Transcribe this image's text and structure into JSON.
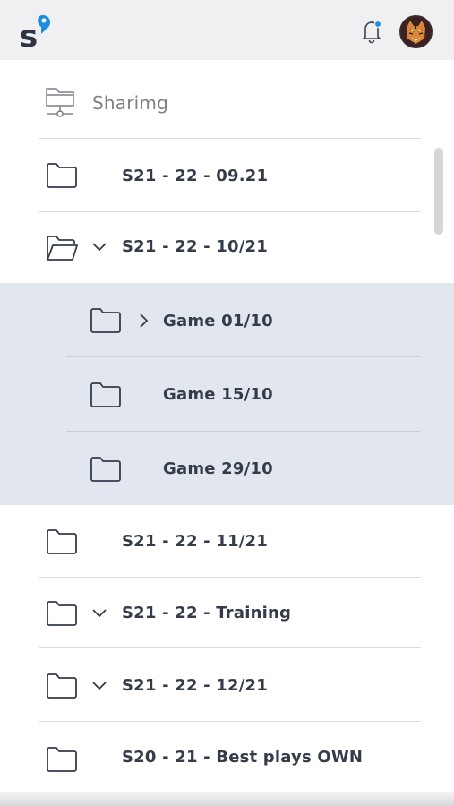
{
  "app": {
    "name": "Sharimg"
  },
  "header": {
    "logo_icon": "s-logo-icon",
    "bell_icon": "bell-icon",
    "avatar_icon": "tiger-avatar"
  },
  "root": {
    "label": "Sharimg",
    "icon": "shared-folder-icon"
  },
  "items": [
    {
      "label": "S21 - 22  - 09.21",
      "icon": "folder-icon",
      "chevron": ""
    },
    {
      "label": "S21 - 22  - 10/21",
      "icon": "folder-open-icon",
      "chevron": "chevron-down-icon"
    },
    {
      "label": "Game 01/10",
      "icon": "folder-icon",
      "chevron": "chevron-right-icon"
    },
    {
      "label": "Game 15/10",
      "icon": "folder-icon",
      "chevron": ""
    },
    {
      "label": "Game 29/10",
      "icon": "folder-icon",
      "chevron": ""
    },
    {
      "label": "S21 - 22  - 11/21",
      "icon": "folder-icon",
      "chevron": ""
    },
    {
      "label": "S21 - 22  - Training",
      "icon": "folder-icon",
      "chevron": "chevron-down-icon"
    },
    {
      "label": "S21 - 22  - 12/21",
      "icon": "folder-icon",
      "chevron": "chevron-down-icon"
    },
    {
      "label": "S20 - 21  - Best plays OWN",
      "icon": "folder-icon",
      "chevron": ""
    }
  ],
  "colors": {
    "header_bg": "#f0f0f2",
    "highlight_bg": "#e2e6ef",
    "text": "#343b49",
    "muted_text": "#7c8088",
    "accent": "#1d8fe0"
  }
}
